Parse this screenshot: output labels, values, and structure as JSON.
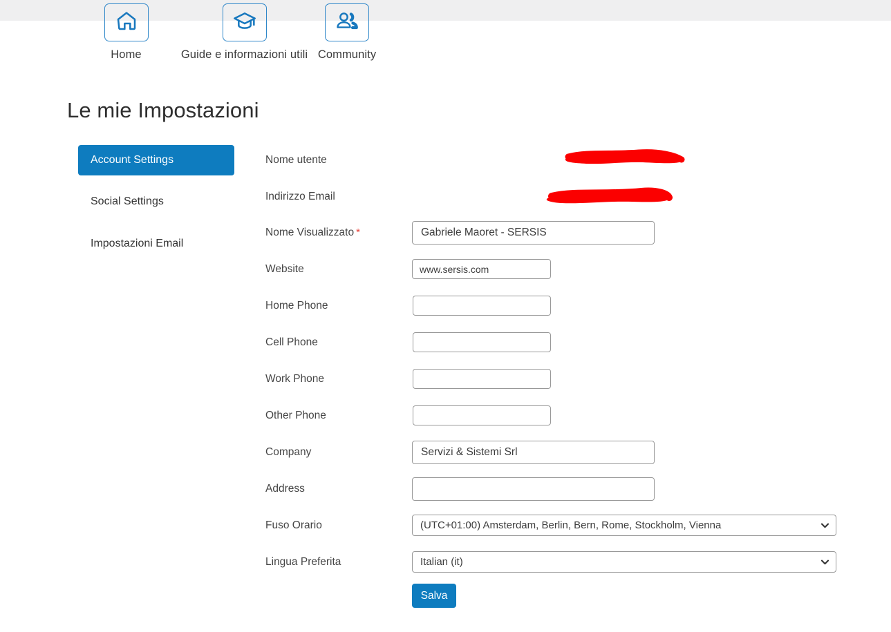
{
  "nav": {
    "items": [
      {
        "label": "Home",
        "icon": "home-icon"
      },
      {
        "label": "Guide e informazioni utili",
        "icon": "graduation-cap-icon"
      },
      {
        "label": "Community",
        "icon": "people-icon"
      }
    ]
  },
  "page": {
    "title": "Le mie Impostazioni"
  },
  "sidebar": {
    "items": [
      {
        "label": "Account Settings",
        "active": true
      },
      {
        "label": "Social Settings",
        "active": false
      },
      {
        "label": "Impostazioni Email",
        "active": false
      }
    ]
  },
  "form": {
    "fields": {
      "username": {
        "label": "Nome utente",
        "value": "",
        "redacted": true
      },
      "email": {
        "label": "Indirizzo Email",
        "value": "",
        "redacted": true
      },
      "display_name": {
        "label": "Nome Visualizzato",
        "required_marker": "*",
        "value": "Gabriele Maoret - SERSIS",
        "placeholder": ""
      },
      "website": {
        "label": "Website",
        "value": "www.sersis.com",
        "placeholder": ""
      },
      "home_phone": {
        "label": "Home Phone",
        "value": "",
        "placeholder": ""
      },
      "cell_phone": {
        "label": "Cell Phone",
        "value": "",
        "placeholder": ""
      },
      "work_phone": {
        "label": "Work Phone",
        "value": "",
        "placeholder": ""
      },
      "other_phone": {
        "label": "Other Phone",
        "value": "",
        "placeholder": ""
      },
      "company": {
        "label": "Company",
        "value": "Servizi & Sistemi Srl",
        "placeholder": ""
      },
      "address": {
        "label": "Address",
        "value": "",
        "placeholder": ""
      },
      "timezone": {
        "label": "Fuso Orario",
        "value": "(UTC+01:00) Amsterdam, Berlin, Bern, Rome, Stockholm, Vienna"
      },
      "language": {
        "label": "Lingua Preferita",
        "value": "Italian (it)"
      }
    },
    "save_button": "Salva"
  },
  "colors": {
    "accent": "#0e7cbf",
    "nav_icon": "#1878be",
    "topbar": "#efeff0",
    "required": "#e8453c",
    "redaction": "#fb0000"
  }
}
